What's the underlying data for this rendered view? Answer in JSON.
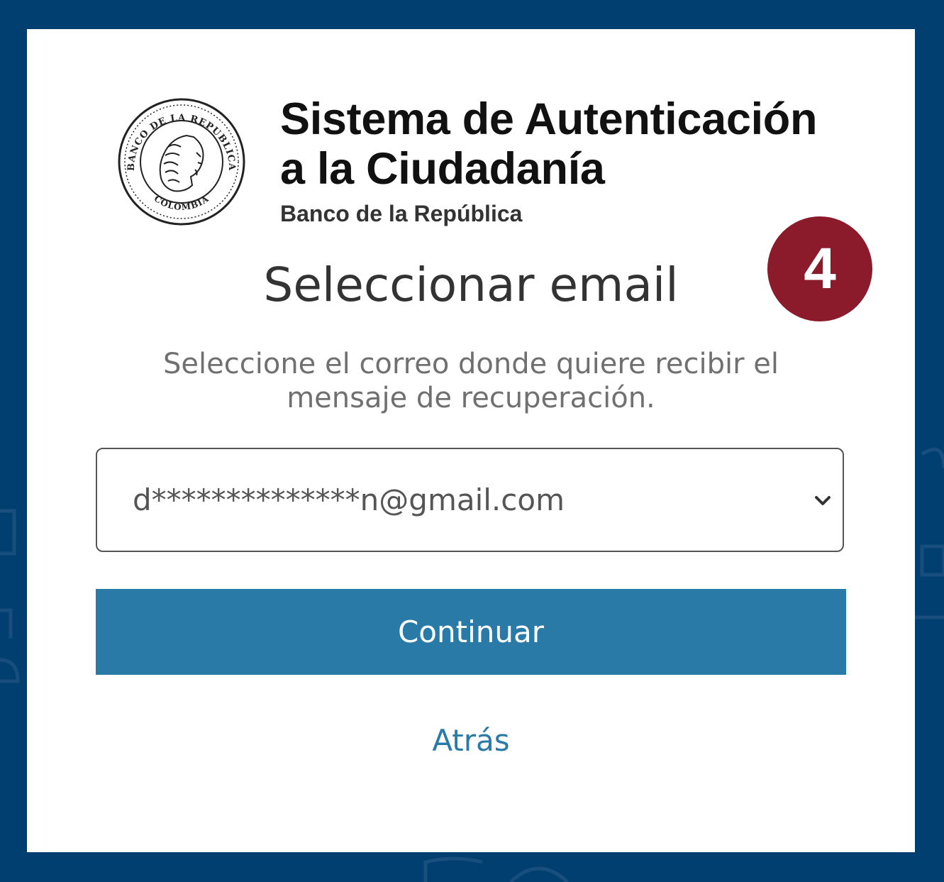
{
  "colors": {
    "background": "#013f71",
    "card": "#ffffff",
    "badge": "#8b1a2b",
    "primary_button": "#2a7aa8",
    "link": "#2a7aa8"
  },
  "header": {
    "logo_icon": "banco-de-la-republica-seal-icon",
    "logo_text_top": "BANCO DE LA REPUBLICA",
    "logo_text_bottom": "COLOMBIA",
    "title": "Sistema de Autenticación\na la Ciudadanía",
    "subtitle": "Banco de la República"
  },
  "step_badge": "4",
  "main": {
    "title": "Seleccionar email",
    "description": "Seleccione el correo donde quiere recibir el mensaje de recuperación.",
    "email_select": {
      "selected_value": "d**************n@gmail.com",
      "icon": "chevron-down-icon"
    },
    "continue_label": "Continuar",
    "back_label": "Atrás"
  }
}
